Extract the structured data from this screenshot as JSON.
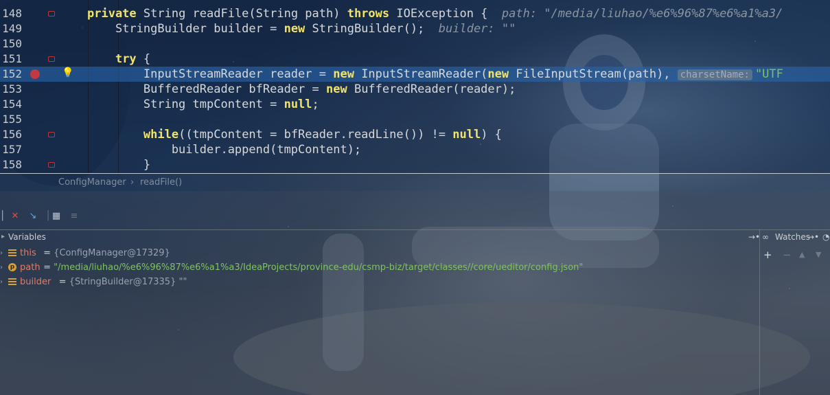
{
  "editor": {
    "lines": [
      {
        "no": "148",
        "tokens": [
          {
            "t": "private",
            "c": "kw"
          },
          {
            "t": " String readFile(String path) "
          },
          {
            "t": "throws",
            "c": "kw"
          },
          {
            "t": " IOException {  "
          },
          {
            "t": "path: \"/media/liuhao/%e6%96%87%e6%a1%a3/",
            "c": "hint"
          }
        ]
      },
      {
        "no": "149",
        "tokens": [
          {
            "t": "    StringBuilder builder = "
          },
          {
            "t": "new",
            "c": "kw"
          },
          {
            "t": " StringBuilder();  "
          },
          {
            "t": "builder: \"\"",
            "c": "hint"
          }
        ]
      },
      {
        "no": "150",
        "tokens": []
      },
      {
        "no": "151",
        "tokens": [
          {
            "t": "    "
          },
          {
            "t": "try",
            "c": "kw"
          },
          {
            "t": " {"
          }
        ]
      },
      {
        "no": "152",
        "tokens": [
          {
            "t": "        InputStreamReader reader = "
          },
          {
            "t": "new",
            "c": "kw"
          },
          {
            "t": " InputStreamReader("
          },
          {
            "t": "new",
            "c": "kw"
          },
          {
            "t": " FileInputStream(path), "
          },
          {
            "t": "charsetName:",
            "c": "param"
          },
          {
            "t": "\"UTF",
            "c": "str"
          }
        ]
      },
      {
        "no": "153",
        "tokens": [
          {
            "t": "        BufferedReader bfReader = "
          },
          {
            "t": "new",
            "c": "kw"
          },
          {
            "t": " BufferedReader(reader);"
          }
        ]
      },
      {
        "no": "154",
        "tokens": [
          {
            "t": "        String tmpContent = "
          },
          {
            "t": "null",
            "c": "kw"
          },
          {
            "t": ";"
          }
        ]
      },
      {
        "no": "155",
        "tokens": []
      },
      {
        "no": "156",
        "tokens": [
          {
            "t": "        "
          },
          {
            "t": "while",
            "c": "kw"
          },
          {
            "t": "((tmpContent = bfReader.readLine()) != "
          },
          {
            "t": "null",
            "c": "kw"
          },
          {
            "t": ") {"
          }
        ]
      },
      {
        "no": "157",
        "tokens": [
          {
            "t": "            builder.append(tmpContent);"
          }
        ]
      },
      {
        "no": "158",
        "tokens": [
          {
            "t": "        }"
          }
        ]
      }
    ],
    "current_line": "152"
  },
  "breadcrumb": {
    "class_name": "ConfigManager",
    "separator": "›",
    "method_name": "readFile()"
  },
  "debug": {
    "variables_title": "Variables",
    "watches_title": "Watches",
    "watch_tools": {
      "add": "+",
      "remove": "−",
      "up": "▲",
      "down": "▼"
    },
    "variables": [
      {
        "kind": "field",
        "name": "this",
        "eq": " = ",
        "type": "{ConfigManager@17329}",
        "value": ""
      },
      {
        "kind": "param",
        "name": "path",
        "eq": " = ",
        "type": "",
        "value": "\"/media/liuhao/%e6%96%87%e6%a1%a3/IdeaProjects/province-edu/csmp-biz/target/classes//core/ueditor/config.json\""
      },
      {
        "kind": "field",
        "name": "builder",
        "eq": " = ",
        "type": "{StringBuilder@17335}",
        "value": " \"\""
      }
    ]
  },
  "colors": {
    "keyword": "#f1e36b",
    "current_line": "#2864aa",
    "breakpoint": "#c23a3f",
    "string": "#7fc45e",
    "var_name": "#e47a63"
  }
}
